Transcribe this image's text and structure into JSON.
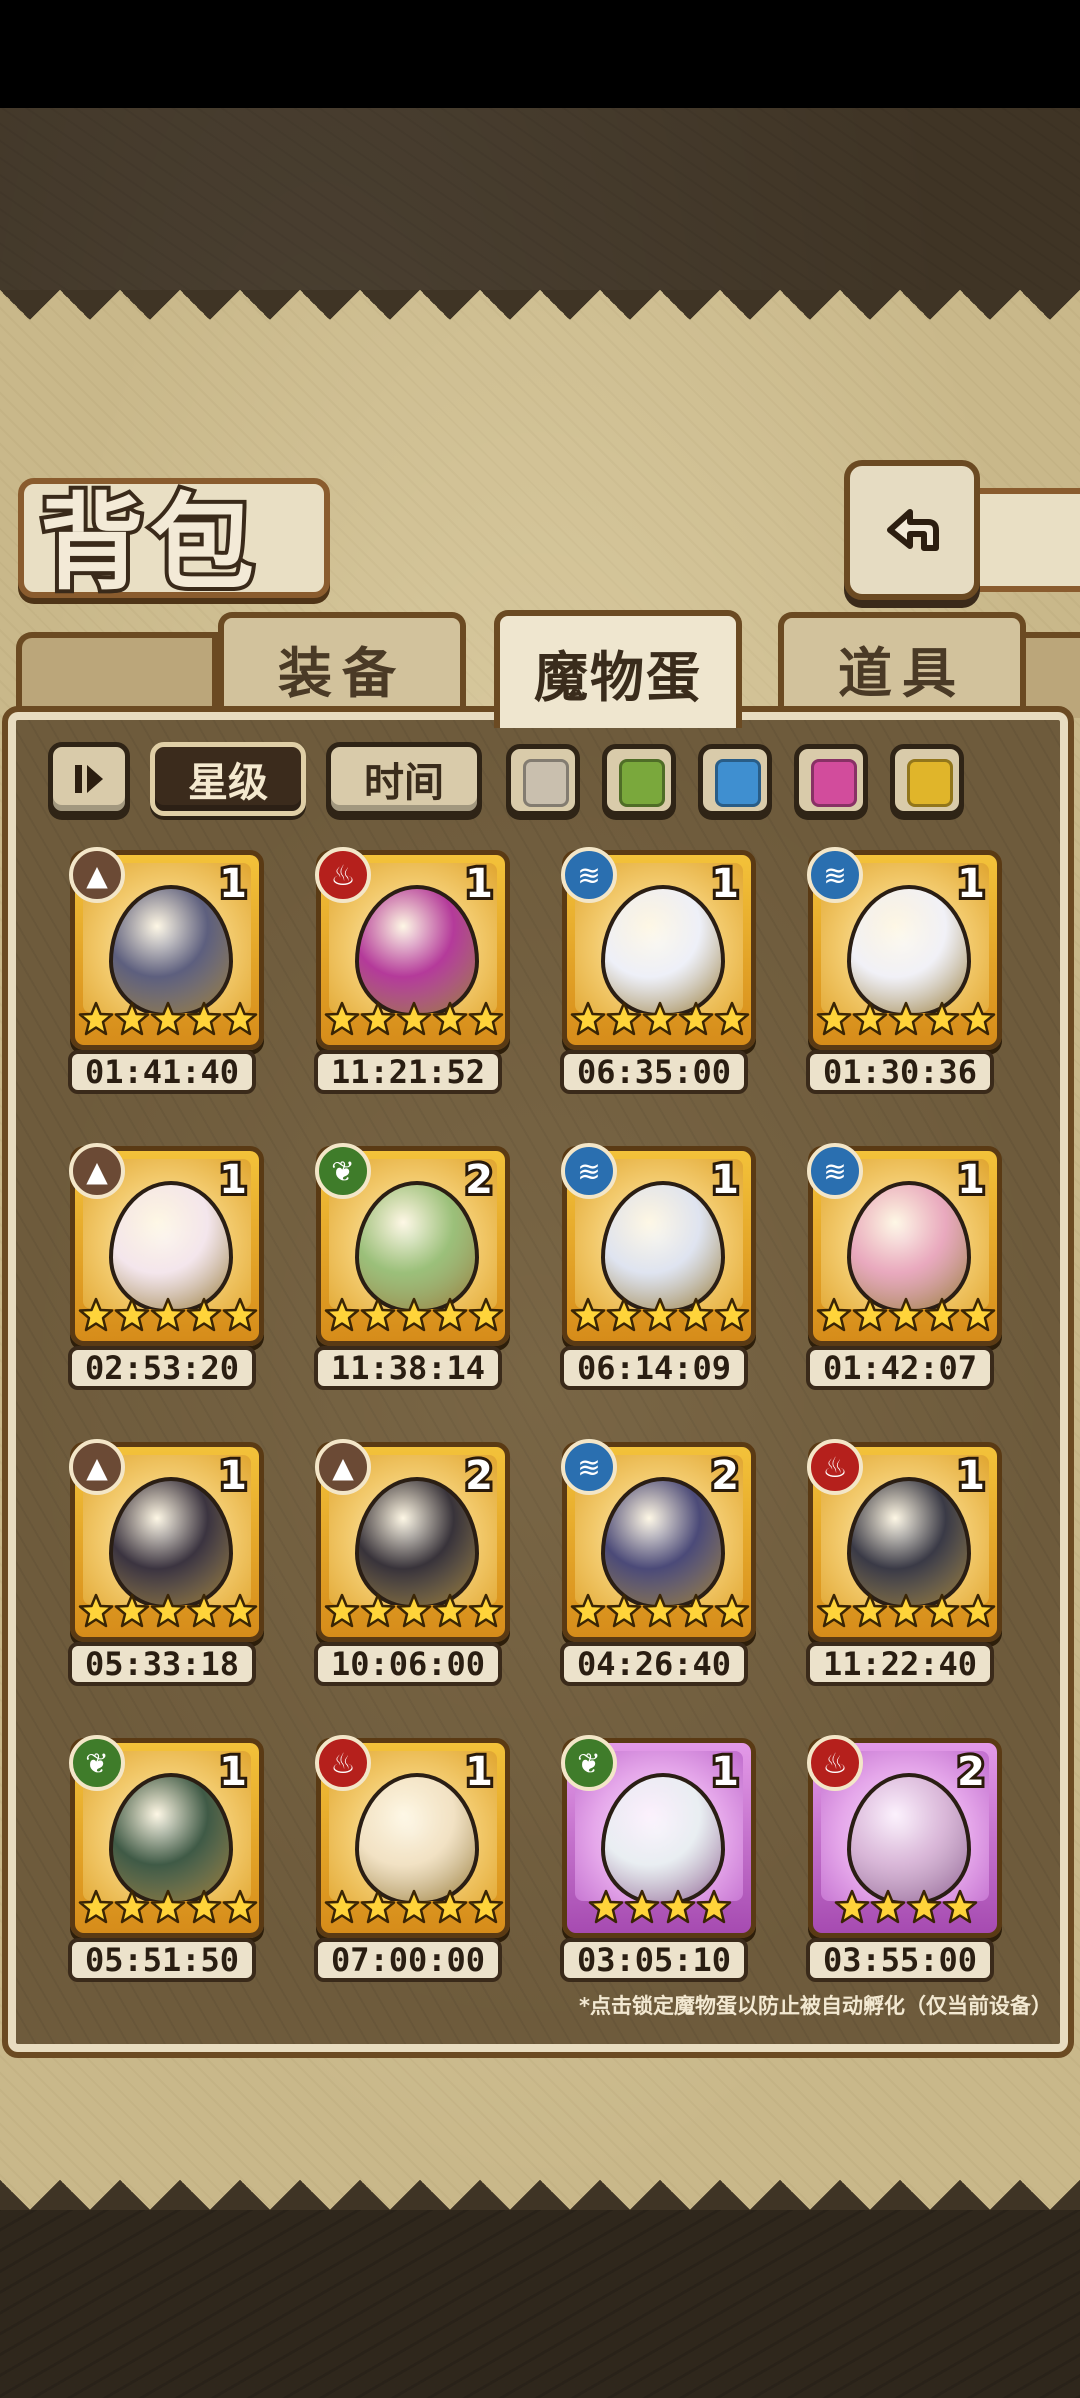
{
  "header": {
    "title": "背包"
  },
  "tabs": [
    {
      "label": "装备",
      "active": false
    },
    {
      "label": "魔物蛋",
      "active": true
    },
    {
      "label": "道具",
      "active": false
    }
  ],
  "filters": {
    "sort_star": "星级",
    "sort_time": "时间",
    "colors": [
      "#c9bfae",
      "#7aa83c",
      "#3f8fd0",
      "#d24c9c",
      "#e0b52a"
    ]
  },
  "eggs": [
    {
      "element": "earth",
      "count": "1",
      "stars": 5,
      "timer": "01:41:40",
      "egg_color": "#5d5f7e",
      "frame": "gold"
    },
    {
      "element": "fire",
      "count": "1",
      "stars": 5,
      "timer": "11:21:52",
      "egg_color": "#b43a9a",
      "frame": "gold"
    },
    {
      "element": "water",
      "count": "1",
      "stars": 5,
      "timer": "06:35:00",
      "egg_color": "#eef0f8",
      "frame": "gold"
    },
    {
      "element": "water",
      "count": "1",
      "stars": 5,
      "timer": "01:30:36",
      "egg_color": "#f1f1f7",
      "frame": "gold"
    },
    {
      "element": "earth",
      "count": "1",
      "stars": 5,
      "timer": "02:53:20",
      "egg_color": "#f4e6ec",
      "frame": "gold"
    },
    {
      "element": "grass",
      "count": "2",
      "stars": 5,
      "timer": "11:38:14",
      "egg_color": "#9bc07a",
      "frame": "gold"
    },
    {
      "element": "water",
      "count": "1",
      "stars": 5,
      "timer": "06:14:09",
      "egg_color": "#dfe4f0",
      "frame": "gold"
    },
    {
      "element": "water",
      "count": "1",
      "stars": 5,
      "timer": "01:42:07",
      "egg_color": "#e9a9be",
      "frame": "gold"
    },
    {
      "element": "earth",
      "count": "1",
      "stars": 5,
      "timer": "05:33:18",
      "egg_color": "#3b3440",
      "frame": "gold"
    },
    {
      "element": "earth",
      "count": "2",
      "stars": 5,
      "timer": "10:06:00",
      "egg_color": "#38333a",
      "frame": "gold"
    },
    {
      "element": "water",
      "count": "2",
      "stars": 5,
      "timer": "04:26:40",
      "egg_color": "#4b4a78",
      "frame": "gold"
    },
    {
      "element": "fire",
      "count": "1",
      "stars": 5,
      "timer": "11:22:40",
      "egg_color": "#3a3a46",
      "frame": "gold"
    },
    {
      "element": "grass",
      "count": "1",
      "stars": 5,
      "timer": "05:51:50",
      "egg_color": "#3f5a46",
      "frame": "gold"
    },
    {
      "element": "fire",
      "count": "1",
      "stars": 5,
      "timer": "07:00:00",
      "egg_color": "#f2e2c4",
      "frame": "gold"
    },
    {
      "element": "grass",
      "count": "1",
      "stars": 4,
      "timer": "03:05:10",
      "egg_color": "#e9eef2",
      "frame": "purple"
    },
    {
      "element": "fire",
      "count": "2",
      "stars": 4,
      "timer": "03:55:00",
      "egg_color": "#d9b7d8",
      "frame": "purple"
    }
  ],
  "hint": "*点击锁定魔物蛋以防止被自动孵化（仅当前设备）"
}
